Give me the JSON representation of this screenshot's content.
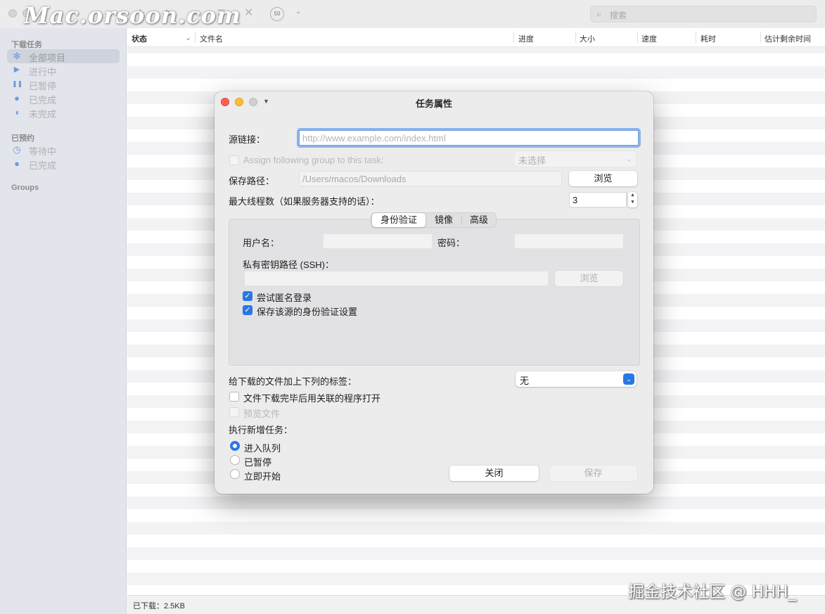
{
  "toolbar": {
    "watermark": "Mac.orsoon.com",
    "add_icon": "+",
    "play_icon": "▶",
    "pause_icon": "⏸",
    "list_icon": "≡",
    "close_icon": "✕",
    "speed_limit_label": "50",
    "chevron_icon": "⌄",
    "search_icon": "⌕",
    "search_placeholder": "搜索"
  },
  "sidebar": {
    "downloads_section": "下载任务",
    "download_items": [
      {
        "icon": "✻",
        "label": "全部项目"
      },
      {
        "icon": "▶",
        "label": "进行中"
      },
      {
        "icon": "❚❚",
        "label": "已暂停"
      },
      {
        "icon": "●",
        "label": "已完成"
      },
      {
        "icon": "◖",
        "label": "未完成"
      }
    ],
    "scheduled_section": "已预约",
    "scheduled_items": [
      {
        "icon": "◷",
        "label": "等待中"
      },
      {
        "icon": "●",
        "label": "已完成"
      }
    ],
    "groups_section": "Groups"
  },
  "list": {
    "columns": [
      "状态",
      "文件名",
      "进度",
      "大小",
      "速度",
      "耗时",
      "估计剩余时间"
    ],
    "sort_chevron": "⌄"
  },
  "statusbar": {
    "downloaded": "已下载：2.5KB"
  },
  "site_watermark": "掘金技术社区 @ HHH_",
  "dialog": {
    "title": "任务属性",
    "dropdown_icon": "▼",
    "source_label": "源链接：",
    "source_placeholder": "http://www.example.com/index.html",
    "assign_group_label": "Assign following group to this task:",
    "group_value": "未选择",
    "save_path_label": "保存路径：",
    "save_path_value": "/Users/macos/Downloads",
    "browse_label": "浏览",
    "max_threads_label": "最大线程数（如果服务器支持的话）：",
    "max_threads_value": "3",
    "tabs": [
      "身份验证",
      "镜像",
      "高级"
    ],
    "active_tab": "身份验证",
    "username_label": "用户名：",
    "username_value": "",
    "password_label": "密码：",
    "password_value": "",
    "ssh_key_label": "私有密钥路径 (SSH)：",
    "ssh_key_value": "",
    "ssh_browse_label": "浏览",
    "anonymous_login_label": "尝试匿名登录",
    "anonymous_login_checked": true,
    "save_auth_label": "保存该源的身份验证设置",
    "save_auth_checked": true,
    "tag_label": "给下载的文件加上下列的标签：",
    "tag_value": "无",
    "open_after_label": "文件下载完毕后用关联的程序打开",
    "preview_label": "预览文件",
    "exec_label": "执行新增任务：",
    "exec_options": [
      "进入队列",
      "已暂停",
      "立即开始"
    ],
    "exec_selected": "进入队列",
    "close_button": "关闭",
    "save_button": "保存",
    "checkmark": "✓",
    "stepper_up": "▲",
    "stepper_down": "▼",
    "popup_arrows": "⌃⌄"
  }
}
